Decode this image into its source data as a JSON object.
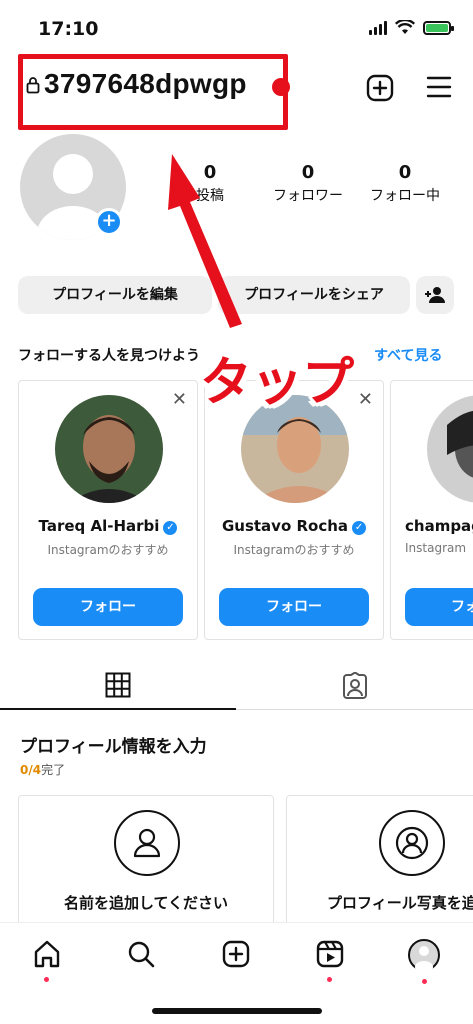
{
  "status_bar": {
    "time": "17:10"
  },
  "header": {
    "username": "3797648dpwgp"
  },
  "profile": {
    "stats": [
      {
        "value": "0",
        "label": "投稿"
      },
      {
        "value": "0",
        "label": "フォロワー"
      },
      {
        "value": "0",
        "label": "フォロー中"
      }
    ],
    "edit_label": "プロフィールを編集",
    "share_label": "プロフィールをシェア"
  },
  "discover": {
    "title": "フォローする人を見つけよう",
    "see_all": "すべて見る",
    "cards": [
      {
        "name": "Tareq Al-Harbi",
        "sub": "Instagramのおすすめ",
        "follow": "フォロー"
      },
      {
        "name": "Gustavo Rocha",
        "sub": "Instagramのおすすめ",
        "follow": "フォロー"
      },
      {
        "name": "champag",
        "sub": "Instagram",
        "follow": "フォ"
      }
    ]
  },
  "complete_profile": {
    "title": "プロフィール情報を入力",
    "progress_fraction": "0/4",
    "progress_suffix": "完了",
    "cards": [
      {
        "title": "名前を追加してください"
      },
      {
        "title": "プロフィール写真を追"
      }
    ]
  },
  "annotation": {
    "text": "タップ",
    "color": "#e5101c"
  },
  "colors": {
    "accent": "#1a8cf5",
    "highlight": "#e5101c"
  }
}
